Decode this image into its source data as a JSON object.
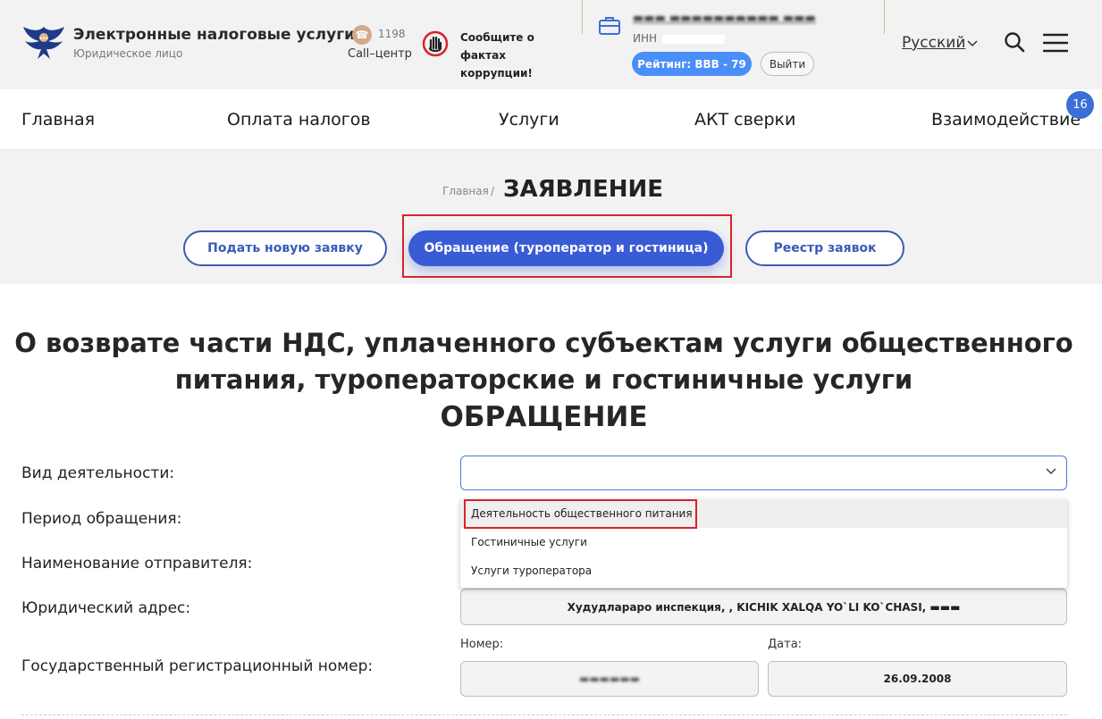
{
  "header": {
    "brand_title": "Электронные налоговые услуги",
    "brand_sub": "Юридическое лицо",
    "phone_number": "1198",
    "phone_label": "Call–центр",
    "corruption_text": "Сообщите о фактах коррупции!",
    "user_name": "▬▬▬ ▬▬▬▬▬▬▬▬▬▬ ▬▬▬",
    "inn_label": "ИНН",
    "rating": "Рейтинг: BBB - 79",
    "logout": "Выйти",
    "language": "Русский"
  },
  "nav": {
    "items": [
      {
        "label": "Главная"
      },
      {
        "label": "Оплата налогов"
      },
      {
        "label": "Услуги"
      },
      {
        "label": "АКТ сверки"
      },
      {
        "label": "Взаимодействие"
      }
    ],
    "badge": "16"
  },
  "breadcrumb": {
    "home": "Главная",
    "separator": "/",
    "title": "ЗАЯВЛЕНИЕ"
  },
  "tabs": [
    {
      "label": "Подать новую заявку"
    },
    {
      "label": "Обращение (туроператор и гостиница)"
    },
    {
      "label": "Реестр заявок"
    }
  ],
  "form": {
    "title_line1": "О возврате части НДС, уплаченного субъектам услуги общественного",
    "title_line2": "питания, туроператорские и гостиничные услуги",
    "subtitle": "ОБРАЩЕНИЕ",
    "labels": {
      "activity": "Вид деятельности:",
      "period": "Период обращения:",
      "sender": "Наименование отправителя:",
      "address": "Юридический адрес:",
      "reg_number": "Государственный регистрационный номер:"
    },
    "activity_value": "",
    "dropdown_options": [
      "Деятельность общественного питания",
      "Гостиничные услуги",
      "Услуги туроператора"
    ],
    "address_value": "Худудлараро инспекция, , KICHIK XALQA YO`LI KO`CHASI, ▬▬▬",
    "number_label": "Номер:",
    "number_value": "▬▬▬▬▬▬",
    "date_label": "Дата:",
    "date_value": "26.09.2008"
  },
  "colors": {
    "accent": "#3a5bd6",
    "rating": "#4a8ef7",
    "highlight": "#d8232a"
  }
}
